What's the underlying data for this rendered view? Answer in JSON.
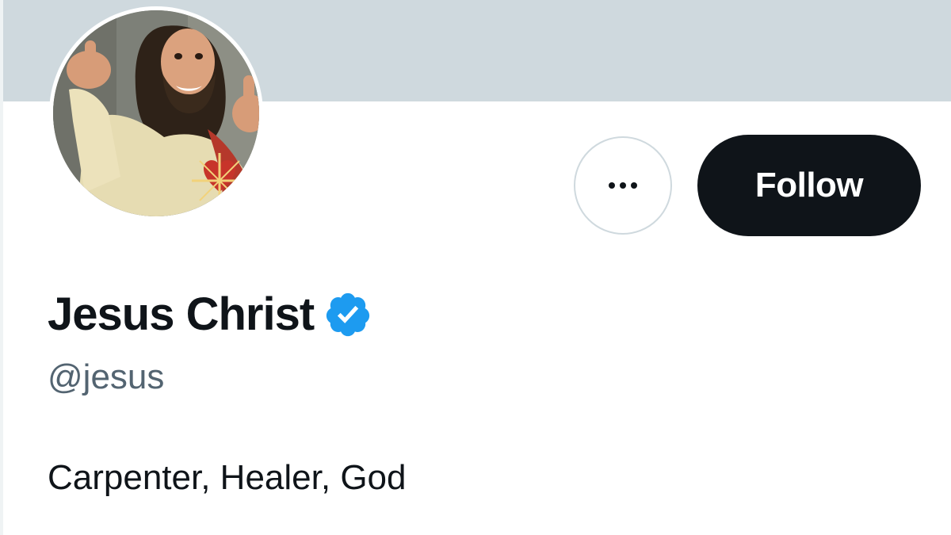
{
  "profile": {
    "display_name": "Jesus Christ",
    "handle": "@jesus",
    "bio": "Carpenter, Healer, God",
    "verified": true
  },
  "actions": {
    "more_icon": "more-dots-icon",
    "follow_label": "Follow"
  },
  "colors": {
    "banner": "#cfd9de",
    "follow_bg": "#0f1419",
    "verified_badge": "#1d9bf0",
    "handle_text": "#536471"
  }
}
